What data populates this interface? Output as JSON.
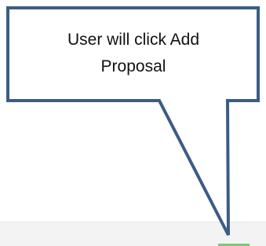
{
  "callout": {
    "text": "User will click Add\nProposal",
    "fill_color": "#ffffff",
    "border_color": "#3b5c86"
  },
  "toolbar": {
    "background_color": "#f3f3f3",
    "highlight_color": "#7cc87a"
  }
}
